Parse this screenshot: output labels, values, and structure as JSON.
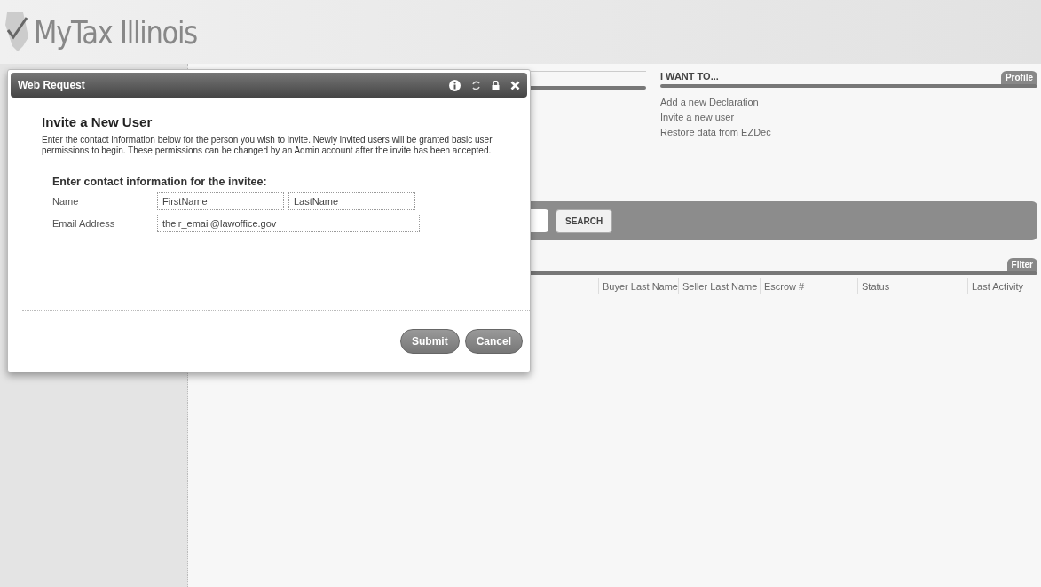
{
  "logo": {
    "text": "MyTax Illinois"
  },
  "actions_panel": {
    "title": "I WANT TO...",
    "tag": "Profile",
    "links": [
      "Add a new Declaration",
      "Invite a new user",
      "Restore data from EZDec"
    ]
  },
  "search_bar": {
    "button": "SEARCH"
  },
  "table": {
    "tag": "Filter",
    "columns": [
      "Buyer Last Name",
      "Seller Last Name",
      "Escrow #",
      "Status",
      "Last Activity"
    ]
  },
  "dialog": {
    "title": "Web Request",
    "heading": "Invite a New User",
    "description": "Enter the contact information below for the person you wish to invite. Newly invited users will be granted basic user permissions to begin. These permissions can be changed by an Admin account after the invite has been accepted.",
    "form_title": "Enter contact information for the invitee:",
    "fields": [
      {
        "label": "Name",
        "inputs": [
          "FirstName",
          "LastName"
        ]
      },
      {
        "label": "Email Address",
        "inputs": [
          "their_email@lawoffice.gov"
        ]
      }
    ],
    "buttons": [
      "Submit",
      "Cancel"
    ]
  }
}
